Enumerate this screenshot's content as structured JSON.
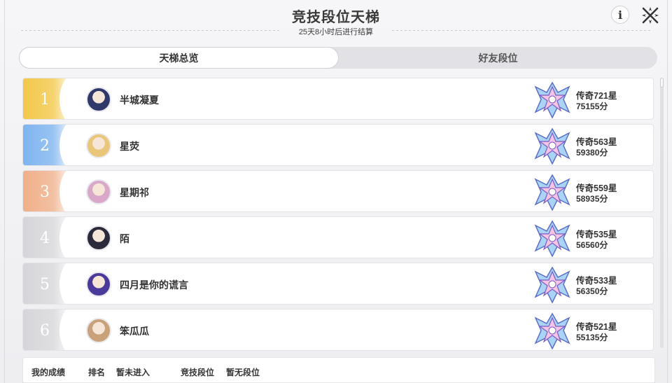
{
  "header": {
    "title": "竞技段位天梯",
    "subtitle": "25天8小时后进行结算",
    "info_label": "i"
  },
  "tabs": [
    {
      "label": "天梯总览",
      "active": true
    },
    {
      "label": "好友段位",
      "active": false
    }
  ],
  "ranking": [
    {
      "rank": "1",
      "name": "半城凝夏",
      "stars": "传奇721星",
      "score": "75155分",
      "rank_color": "#f2c84a",
      "avatar_color": "#2f3a6b"
    },
    {
      "rank": "2",
      "name": "星荧",
      "stars": "传奇563星",
      "score": "59380分",
      "rank_color": "#7fb4ef",
      "avatar_color": "#e9c67a"
    },
    {
      "rank": "3",
      "name": "星期祁",
      "stars": "传奇559星",
      "score": "58935分",
      "rank_color": "#efb08a",
      "avatar_color": "#d9a8c8"
    },
    {
      "rank": "4",
      "name": "陌",
      "stars": "传奇535星",
      "score": "56560分",
      "rank_color": "#d6d6da",
      "avatar_color": "#2a2a3a"
    },
    {
      "rank": "5",
      "name": "四月是你的谎言",
      "stars": "传奇533星",
      "score": "56350分",
      "rank_color": "#d6d6da",
      "avatar_color": "#4b3a9a"
    },
    {
      "rank": "6",
      "name": "笨瓜瓜",
      "stars": "传奇521星",
      "score": "55135分",
      "rank_color": "#d6d6da",
      "avatar_color": "#c9a27a"
    }
  ],
  "my_record": {
    "label": "我的成绩",
    "rank_label": "排名",
    "rank_value": "暂未进入",
    "tier_label": "竞技段位",
    "tier_value": "暂无段位"
  },
  "icons": {
    "info": "info-icon",
    "close": "close-icon",
    "emblem": "legend-rank-emblem-icon"
  }
}
